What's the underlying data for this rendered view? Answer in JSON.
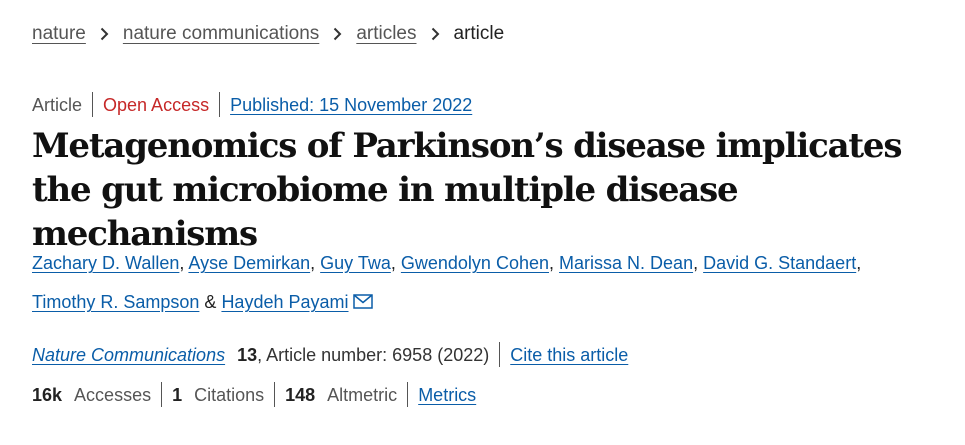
{
  "breadcrumb": {
    "items": [
      "nature",
      "nature communications",
      "articles"
    ],
    "current": "article"
  },
  "meta": {
    "type": "Article",
    "access": "Open Access",
    "published": "Published: 15 November 2022"
  },
  "title": "Metagenomics of Parkinson’s disease implicates the gut microbiome in multiple disease mechanisms",
  "authors": [
    "Zachary D. Wallen",
    "Ayse Demirkan",
    "Guy Twa",
    "Gwendolyn Cohen",
    "Marissa N. Dean",
    "David G. Standaert",
    "Timothy R. Sampson",
    "Haydeh Payami"
  ],
  "author_separators": {
    "comma": ",",
    "ampersand": "&"
  },
  "journal": {
    "name": "Nature Communications",
    "volume": "13",
    "article_number": ", Article number: 6958 (2022)",
    "cite_label": "Cite this article"
  },
  "metrics": {
    "accesses_value": "16k",
    "accesses_label": "Accesses",
    "citations_value": "1",
    "citations_label": "Citations",
    "altmetric_value": "148",
    "altmetric_label": "Altmetric",
    "metrics_link": "Metrics"
  },
  "colors": {
    "link": "#0a5da8",
    "open_access": "#c62828",
    "muted": "#555555",
    "text": "#222222"
  },
  "icons": {
    "breadcrumb_separator": "chevron-right-icon",
    "corresponding_author": "envelope-icon"
  }
}
